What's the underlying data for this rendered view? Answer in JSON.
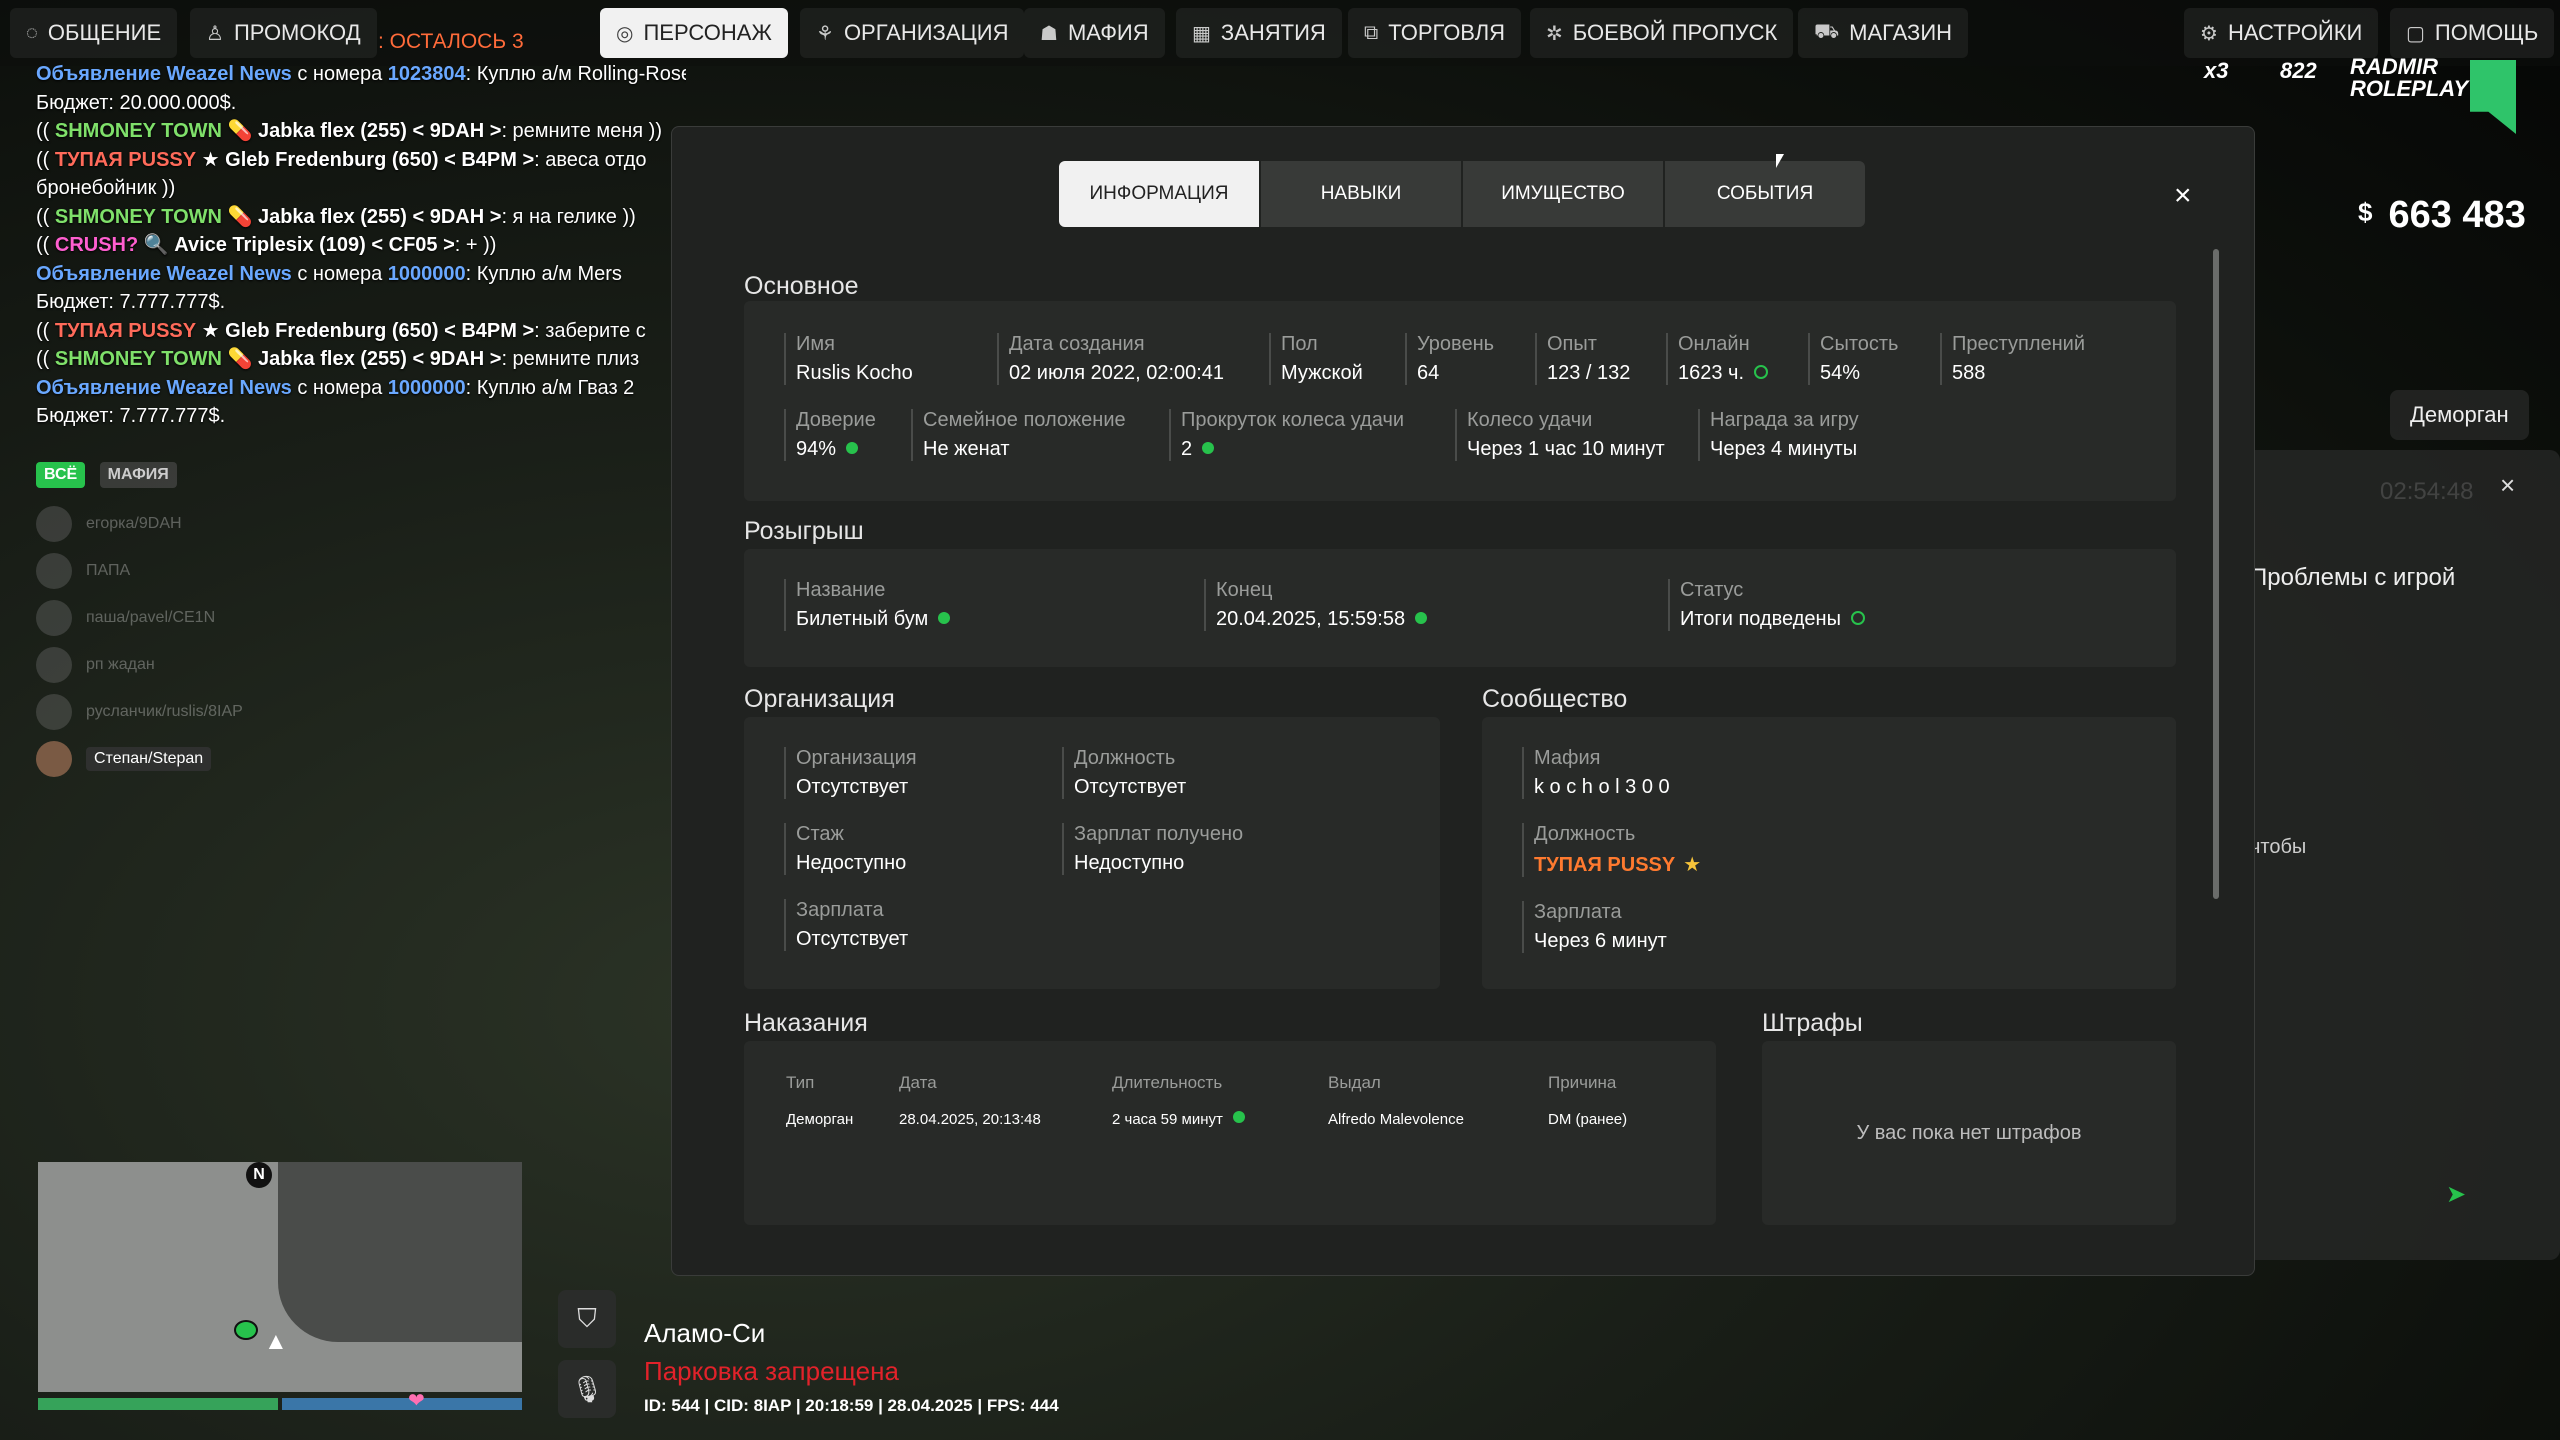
{
  "nav": {
    "chat": "ОБЩЕНИЕ",
    "promo": "ПРОМОКОД",
    "promo_remaining": ": ОСТАЛОСЬ 3",
    "character": "ПЕРСОНАЖ",
    "organization": "ОРГАНИЗАЦИЯ",
    "mafia": "МАФИЯ",
    "jobs": "ЗАНЯТИЯ",
    "trade": "ТОРГОВЛЯ",
    "battlepass": "БОЕВОЙ ПРОПУСК",
    "shop": "МАГАЗИН",
    "settings": "НАСТРОЙКИ",
    "help": "ПОМОЩЬ"
  },
  "chat": {
    "lines": [
      {
        "prefix": "Объявление Weazel News",
        "mid": " с номера ",
        "num": "1023804",
        "text": ": Куплю а/м Rolling-Roses Cullman."
      },
      {
        "plain": "Бюджет: 20.000.000$."
      },
      {
        "open": "(( ",
        "faction": "SHMONEY TOWN",
        "sym": " 💊 ",
        "name": "Jabka flex (255) < 9DAH >",
        "text": ": ремните меня ))"
      },
      {
        "open": "(( ",
        "faction": "ТУПАЯ PUSSY",
        "sym": " ★ ",
        "name": "Gleb Fredenburg (650) < B4PM >",
        "text": ": авеса отдо"
      },
      {
        "plain": "бронебойник ))"
      },
      {
        "open": "(( ",
        "faction": "SHMONEY TOWN",
        "sym": " 💊 ",
        "name": "Jabka flex (255) < 9DAH >",
        "text": ": я на гелике ))"
      },
      {
        "open": "(( ",
        "faction": "CRUSH?",
        "sym": " 🔍 ",
        "name": "Avice Triplesix (109) < CF05 >",
        "text": ": + ))"
      },
      {
        "prefix": "Объявление Weazel News",
        "mid": " с номера ",
        "num": "1000000",
        "text": ": Куплю а/м Mers"
      },
      {
        "plain": "Бюджет: 7.777.777$."
      },
      {
        "open": "(( ",
        "faction": "ТУПАЯ PUSSY",
        "sym": " ★ ",
        "name": "Gleb Fredenburg (650) < B4PM >",
        "text": ": заберите с"
      },
      {
        "open": "(( ",
        "faction": "SHMONEY TOWN",
        "sym": " 💊 ",
        "name": "Jabka flex (255) < 9DAH >",
        "text": ": ремните плиз"
      },
      {
        "prefix": "Объявление Weazel News",
        "mid": " с номера ",
        "num": "1000000",
        "text": ": Куплю а/м Гваз 2"
      },
      {
        "plain": "Бюджет: 7.777.777$."
      }
    ]
  },
  "voice": {
    "tab_all": "ВСЁ",
    "tab_mafia": "МАФИЯ",
    "rows": [
      "егорка/9DAH",
      "ПАПА",
      "паша/pavel/CE1N",
      "рп жадан",
      "русланчик/ruslis/8IAP",
      "Степан/Stepan"
    ]
  },
  "hud": {
    "money_symbol": "$",
    "money": "663 483",
    "logo_top": "RADMIR",
    "logo_bottom": "ROLEPLAY",
    "multiplier": "x3",
    "server": "822",
    "bg_chip": "Деморган",
    "bg_problems": "Проблемы с игрой",
    "bg_snippet": "чтобы",
    "bg_time": "02:54:48",
    "location": "Аламо-Си",
    "parking": "Парковка запрещена",
    "status_line": "ID: 544 | CID: 8IAP | 20:18:59  | 28.04.2025 | FPS: 444",
    "compass": "N"
  },
  "modal": {
    "tabs": [
      "ИНФОРМАЦИЯ",
      "НАВЫКИ",
      "ИМУЩЕСТВО",
      "СОБЫТИЯ"
    ],
    "close": "×",
    "basic": {
      "title": "Основное",
      "row1": [
        {
          "label": "Имя",
          "value": "Ruslis Kocho"
        },
        {
          "label": "Дата создания",
          "value": "02 июля 2022, 02:00:41"
        },
        {
          "label": "Пол",
          "value": "Мужской"
        },
        {
          "label": "Уровень",
          "value": "64"
        },
        {
          "label": "Опыт",
          "value": "123 / 132"
        },
        {
          "label": "Онлайн",
          "value": "1623 ч."
        },
        {
          "label": "Сытость",
          "value": "54%"
        },
        {
          "label": "Преступлений",
          "value": "588"
        }
      ],
      "row2": [
        {
          "label": "Доверие",
          "value": "94%"
        },
        {
          "label": "Семейное положение",
          "value": "Не женат"
        },
        {
          "label": "Прокруток колеса удачи",
          "value": "2"
        },
        {
          "label": "Колесо удачи",
          "value": "Через 1 час 10 минут"
        },
        {
          "label": "Награда за игру",
          "value": "Через 4 минуты"
        }
      ]
    },
    "raffle": {
      "title": "Розыгрыш",
      "name_label": "Название",
      "name_value": "Билетный бум",
      "end_label": "Конец",
      "end_value": "20.04.2025, 15:59:58",
      "status_label": "Статус",
      "status_value": "Итоги подведены"
    },
    "org": {
      "title": "Организация",
      "org_label": "Организация",
      "org_value": "Отсутствует",
      "pos_label": "Должность",
      "pos_value": "Отсутствует",
      "exp_label": "Стаж",
      "exp_value": "Недоступно",
      "salary_got_label": "Зарплат получено",
      "salary_got_value": "Недоступно",
      "salary_label": "Зарплата",
      "salary_value": "Отсутствует"
    },
    "community": {
      "title": "Сообщество",
      "mafia_label": "Мафия",
      "mafia_value": "k o c h o l 3 0 0",
      "pos_label": "Должность",
      "pos_value": "ТУПАЯ PUSSY",
      "salary_label": "Зарплата",
      "salary_value": "Через 6 минут"
    },
    "punishments": {
      "title": "Наказания",
      "headers": [
        "Тип",
        "Дата",
        "Длительность",
        "Выдал",
        "Причина"
      ],
      "row": [
        "Деморган",
        "28.04.2025, 20:13:48",
        "2 часа 59 минут",
        "Alfredo Malevolence",
        "DM (ранее)"
      ]
    },
    "fines": {
      "title": "Штрафы",
      "empty": "У вас пока нет штрафов"
    }
  }
}
